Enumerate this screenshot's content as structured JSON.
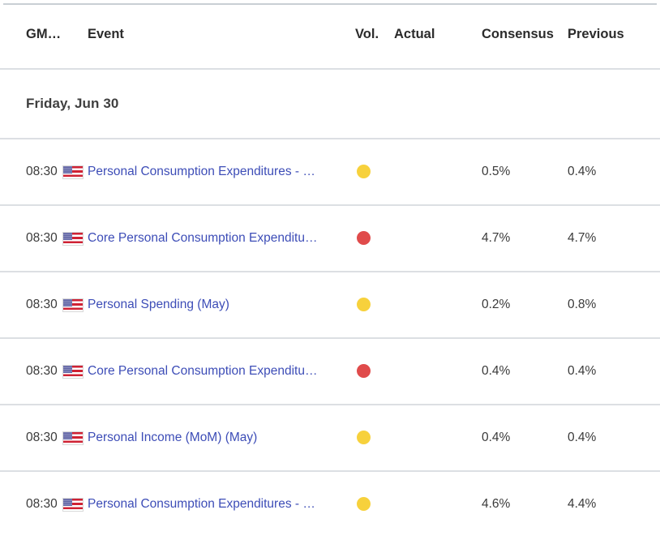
{
  "table": {
    "columns": [
      {
        "key": "time",
        "label": "GM…"
      },
      {
        "key": "event",
        "label": "Event"
      },
      {
        "key": "vol",
        "label": "Vol."
      },
      {
        "key": "actual",
        "label": "Actual"
      },
      {
        "key": "consensus",
        "label": "Consensus"
      },
      {
        "key": "previous",
        "label": "Previous"
      }
    ],
    "day_group": {
      "label": "Friday, Jun 30"
    },
    "rows": [
      {
        "time": "08:30",
        "flag": "us-flag-icon",
        "event": "Personal Consumption Expenditures - …",
        "truncated": true,
        "volatility": "moderate",
        "volatility_color": "#f7d13c",
        "actual": "",
        "consensus": "0.5%",
        "previous": "0.4%"
      },
      {
        "time": "08:30",
        "flag": "us-flag-icon",
        "event": "Core Personal Consumption Expenditu…",
        "truncated": true,
        "volatility": "high",
        "volatility_color": "#e04b4b",
        "actual": "",
        "consensus": "4.7%",
        "previous": "4.7%"
      },
      {
        "time": "08:30",
        "flag": "us-flag-icon",
        "event": "Personal Spending (May)",
        "truncated": false,
        "volatility": "moderate",
        "volatility_color": "#f7d13c",
        "actual": "",
        "consensus": "0.2%",
        "previous": "0.8%"
      },
      {
        "time": "08:30",
        "flag": "us-flag-icon",
        "event": "Core Personal Consumption Expenditu…",
        "truncated": true,
        "volatility": "high",
        "volatility_color": "#e04b4b",
        "actual": "",
        "consensus": "0.4%",
        "previous": "0.4%"
      },
      {
        "time": "08:30",
        "flag": "us-flag-icon",
        "event": "Personal Income (MoM) (May)",
        "truncated": false,
        "volatility": "moderate",
        "volatility_color": "#f7d13c",
        "actual": "",
        "consensus": "0.4%",
        "previous": "0.4%"
      },
      {
        "time": "08:30",
        "flag": "us-flag-icon",
        "event": "Personal Consumption Expenditures - …",
        "truncated": true,
        "volatility": "moderate",
        "volatility_color": "#f7d13c",
        "actual": "",
        "consensus": "4.6%",
        "previous": "4.4%"
      }
    ]
  },
  "colors": {
    "link": "#3d4db7",
    "text": "#3a3a3a",
    "rule": "#dcdfe3",
    "volatility_moderate": "#f7d13c",
    "volatility_high": "#e04b4b"
  }
}
